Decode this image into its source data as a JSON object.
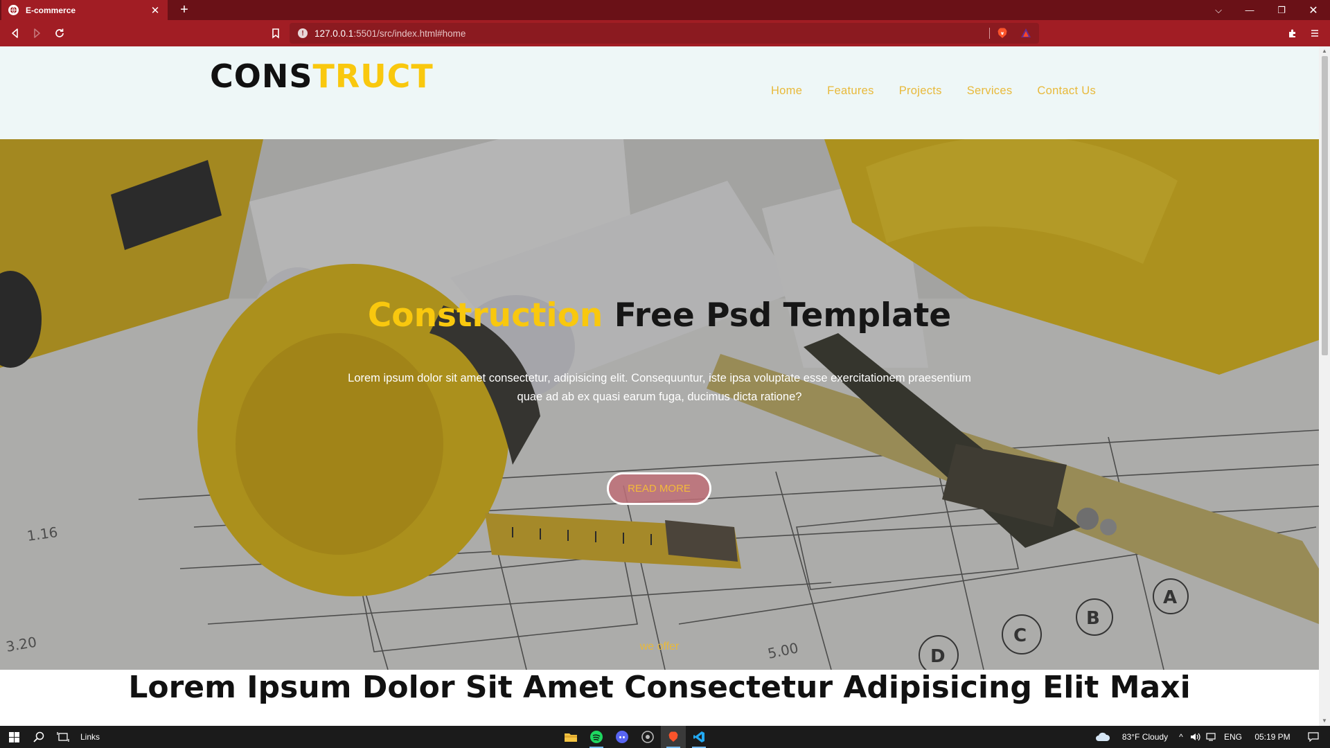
{
  "browser": {
    "tab_title": "E-commerce",
    "url_host": "127.0.0.1",
    "url_path": ":5501/src/index.html#home"
  },
  "site": {
    "logo_part1": "CONS",
    "logo_part2": "TRUCT",
    "nav": [
      {
        "label": "Home"
      },
      {
        "label": "Features"
      },
      {
        "label": "Projects"
      },
      {
        "label": "Services"
      },
      {
        "label": "Contact Us"
      }
    ],
    "hero": {
      "title_highlight": "Construction",
      "title_rest": " Free Psd Template",
      "text": "Lorem ipsum dolor sit amet consectetur, adipisicing elit. Consequuntur, iste ipsa voluptate esse exercitationem praesentium quae ad ab ex quasi earum fuga, ducimus dicta ratione?",
      "button": "READ MORE"
    },
    "offer_label": "we offer",
    "section_heading": "Lorem Ipsum Dolor Sit Amet Consectetur Adipisicing Elit Maxi"
  },
  "taskbar": {
    "links_label": "Links",
    "weather": "83°F  Cloudy",
    "lang": "ENG",
    "time": "05:19 PM"
  },
  "colors": {
    "brand_yellow": "#f9c80e",
    "nav_gold": "#e8b93a",
    "browser_red": "#a11d24"
  }
}
